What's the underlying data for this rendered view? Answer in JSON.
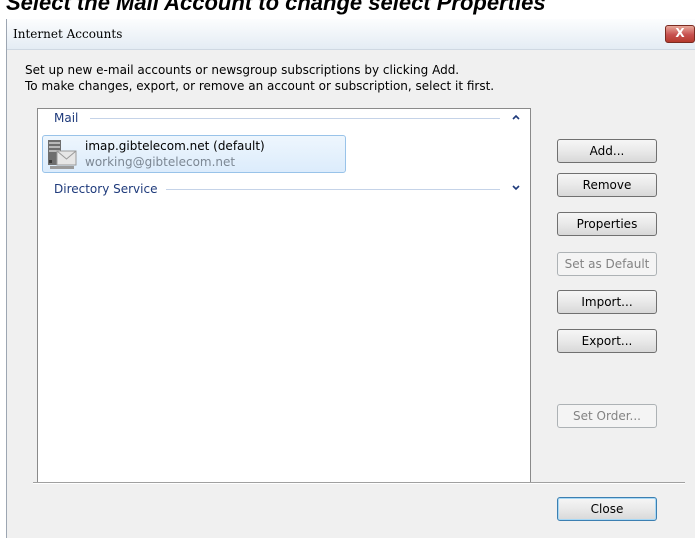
{
  "banner": {
    "text": "Select the Mail Account to change select Properties"
  },
  "window": {
    "title": "Internet Accounts",
    "close_glyph": "X"
  },
  "description": {
    "line1": "Set up new e-mail accounts or newsgroup subscriptions by clicking Add.",
    "line2": "To make changes, export, or remove an account or subscription, select it first."
  },
  "groups": {
    "mail": {
      "label": "Mail",
      "expanded": true,
      "chevron": "chevron-up-icon",
      "accounts": [
        {
          "name": "imap.gibtelecom.net (default)",
          "email": "working@gibtelecom.net",
          "selected": true,
          "icon": "mail-account-icon"
        }
      ]
    },
    "directory": {
      "label": "Directory Service",
      "expanded": false,
      "chevron": "chevron-down-icon"
    }
  },
  "buttons": {
    "add": {
      "label": "Add...",
      "enabled": true
    },
    "remove": {
      "label": "Remove",
      "enabled": true
    },
    "properties": {
      "label": "Properties",
      "enabled": true
    },
    "set_default": {
      "label": "Set as Default",
      "enabled": false
    },
    "import": {
      "label": "Import...",
      "enabled": true
    },
    "export": {
      "label": "Export...",
      "enabled": true
    },
    "set_order": {
      "label": "Set Order...",
      "enabled": false
    },
    "close": {
      "label": "Close",
      "enabled": true
    }
  },
  "colors": {
    "group_header": "#1e3a7b",
    "selection_fill": "#dcecfc",
    "selection_border": "#99c3e9",
    "close_button": "#c75050"
  }
}
